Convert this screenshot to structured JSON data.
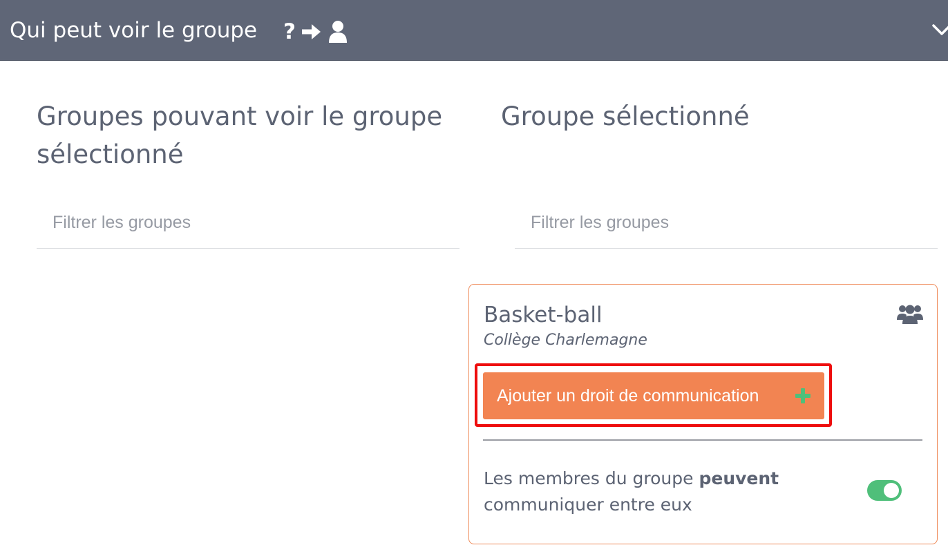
{
  "header": {
    "title": "Qui peut voir le groupe",
    "help_mark": "?",
    "icons": [
      "arrow-right-icon",
      "user-icon",
      "chevron-down-icon"
    ]
  },
  "left_column": {
    "title": "Groupes pouvant voir le groupe sélectionné",
    "filter_placeholder": "Filtrer les groupes"
  },
  "right_column": {
    "title": "Groupe sélectionné",
    "filter_placeholder": "Filtrer les groupes"
  },
  "group_card": {
    "name": "Basket-ball",
    "school": "Collège Charlemagne",
    "add_button_label": "Ajouter un droit de communication",
    "communication": {
      "text_before": "Les membres du groupe ",
      "text_bold": "peuvent",
      "text_after": " communiquer entre eux",
      "enabled": true
    }
  },
  "colors": {
    "header_bg": "#5f6677",
    "accent_orange": "#f28452",
    "highlight_red": "#ee0d0d",
    "toggle_green": "#4fbf7a",
    "text": "#5c6373"
  }
}
